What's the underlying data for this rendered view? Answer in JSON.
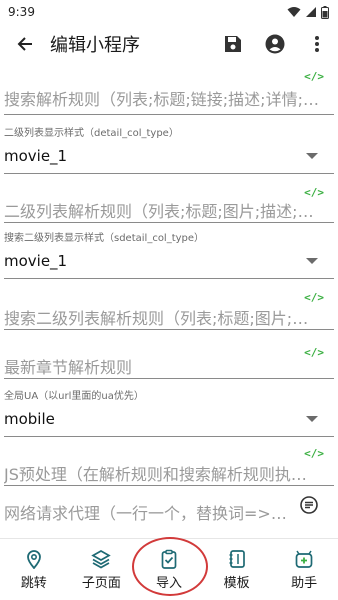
{
  "status": {
    "time": "9:39"
  },
  "appbar": {
    "title": "编辑小程序"
  },
  "fields": {
    "search_rule": {
      "placeholder": "搜索解析规则（列表;标题;链接;描述;详情;…",
      "code_tag": "</>"
    },
    "detail_col_type": {
      "label": "二级列表显示样式（detail_col_type）",
      "value": "movie_1"
    },
    "second_list_rule": {
      "placeholder": "二级列表解析规则（列表;标题;图片;描述;…",
      "code_tag": "</>"
    },
    "sdetail_col_type": {
      "label": "搜索二级列表显示样式（sdetail_col_type）",
      "value": "movie_1"
    },
    "search_second_rule": {
      "placeholder": "搜索二级列表解析规则（列表;标题;图片;描…",
      "code_tag": "</>"
    },
    "latest_chapter_rule": {
      "placeholder": "最新章节解析规则",
      "code_tag": "</>"
    },
    "global_ua": {
      "label": "全局UA（以url里面的ua优先）",
      "value": "mobile"
    },
    "js_preprocess": {
      "placeholder": "JS预处理（在解析规则和搜索解析规则执…",
      "code_tag": "</>"
    },
    "proxy": {
      "placeholder": "网络请求代理（一行一个，替换词=>…"
    }
  },
  "bottom_nav": [
    {
      "label": "跳转",
      "icon": "location-pin-icon"
    },
    {
      "label": "子页面",
      "icon": "layers-icon"
    },
    {
      "label": "导入",
      "icon": "clipboard-check-icon"
    },
    {
      "label": "模板",
      "icon": "notebook-icon"
    },
    {
      "label": "助手",
      "icon": "robot-plus-icon"
    }
  ],
  "colors": {
    "code_tag": "#3cb043",
    "highlight": "#d23a3a"
  }
}
